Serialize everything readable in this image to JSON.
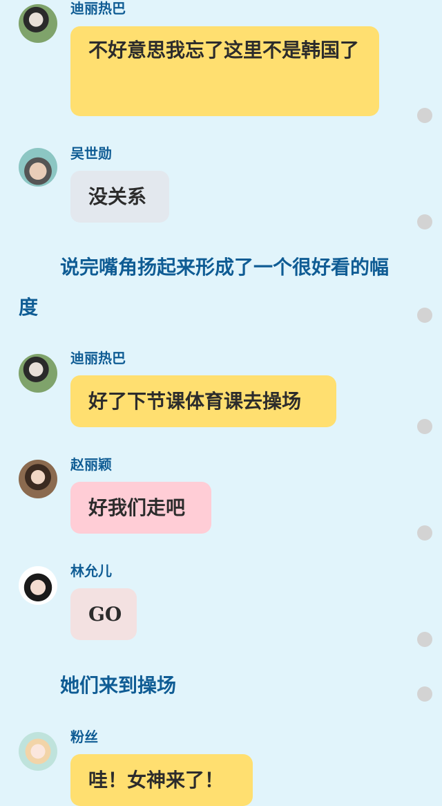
{
  "messages": [
    {
      "name": "迪丽热巴",
      "text": "不好意思我忘了这里不是韩国了",
      "color": "#ffdf70",
      "avatar": "woman-in-garden-avatar"
    },
    {
      "name": "吴世勋",
      "text": "没关系",
      "color": "#e3e8ee",
      "avatar": "man-grey-hair-avatar"
    },
    {
      "name": "迪丽热巴",
      "text": "好了下节课体育课去操场",
      "color": "#ffdf70",
      "avatar": "woman-in-garden-avatar"
    },
    {
      "name": "赵丽颖",
      "text": "好我们走吧",
      "color": "#ffcdd6",
      "avatar": "woman-long-hair-avatar"
    },
    {
      "name": "林允儿",
      "text": "GO",
      "color": "#f3e1e1",
      "avatar": "woman-bangs-avatar"
    },
    {
      "name": "粉丝",
      "text": "哇！女神来了！",
      "color": "#ffdf70",
      "avatar": "anime-girl-avatar"
    }
  ],
  "narration": [
    "说完嘴角扬起来形成了一个很好看的幅度",
    "她们来到操场"
  ]
}
